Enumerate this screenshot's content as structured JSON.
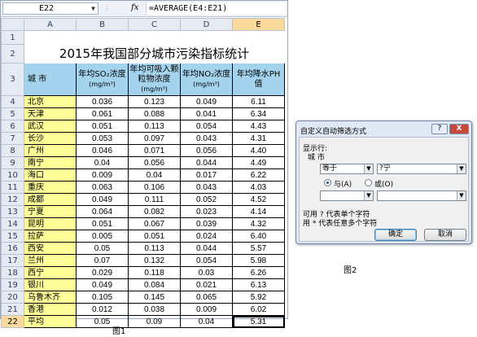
{
  "formula_bar": {
    "name_box": "E22",
    "fx_label": "fx",
    "formula": "=AVERAGE(E4:E21)"
  },
  "columns": [
    "A",
    "B",
    "C",
    "D",
    "E"
  ],
  "title": "2015年我国部分城市污染指标统计",
  "headers": {
    "city": "城    市",
    "so2": "年均SO₂浓度",
    "so2_unit": "(mg/m³)",
    "pm": "年均可吸入颗粒物浓度",
    "pm_unit": "(mg/m³)",
    "no2": "年均NO₂浓度",
    "no2_unit": "(mg/m³)",
    "ph": "年均降水PH值"
  },
  "rows": [
    {
      "r": "4",
      "city": "北京",
      "so2": "0.036",
      "pm": "0.123",
      "no2": "0.049",
      "ph": "6.11"
    },
    {
      "r": "5",
      "city": "天津",
      "so2": "0.061",
      "pm": "0.088",
      "no2": "0.041",
      "ph": "6.34"
    },
    {
      "r": "6",
      "city": "武汉",
      "so2": "0.051",
      "pm": "0.113",
      "no2": "0.054",
      "ph": "4.43"
    },
    {
      "r": "7",
      "city": "长沙",
      "so2": "0.053",
      "pm": "0.097",
      "no2": "0.043",
      "ph": "4.31"
    },
    {
      "r": "8",
      "city": "广州",
      "so2": "0.046",
      "pm": "0.071",
      "no2": "0.056",
      "ph": "4.40"
    },
    {
      "r": "9",
      "city": "南宁",
      "so2": "0.04",
      "pm": "0.056",
      "no2": "0.044",
      "ph": "4.49"
    },
    {
      "r": "10",
      "city": "海口",
      "so2": "0.009",
      "pm": "0.04",
      "no2": "0.017",
      "ph": "6.22"
    },
    {
      "r": "11",
      "city": "重庆",
      "so2": "0.063",
      "pm": "0.106",
      "no2": "0.043",
      "ph": "4.03"
    },
    {
      "r": "12",
      "city": "成都",
      "so2": "0.049",
      "pm": "0.111",
      "no2": "0.052",
      "ph": "4.52"
    },
    {
      "r": "13",
      "city": "宁夏",
      "so2": "0.064",
      "pm": "0.082",
      "no2": "0.023",
      "ph": "4.14"
    },
    {
      "r": "14",
      "city": "昆明",
      "so2": "0.051",
      "pm": "0.067",
      "no2": "0.039",
      "ph": "4.32"
    },
    {
      "r": "15",
      "city": "拉萨",
      "so2": "0.005",
      "pm": "0.051",
      "no2": "0.024",
      "ph": "6.40"
    },
    {
      "r": "16",
      "city": "西安",
      "so2": "0.05",
      "pm": "0.113",
      "no2": "0.044",
      "ph": "5.57"
    },
    {
      "r": "17",
      "city": "兰州",
      "so2": "0.07",
      "pm": "0.132",
      "no2": "0.054",
      "ph": "5.98"
    },
    {
      "r": "18",
      "city": "西宁",
      "so2": "0.029",
      "pm": "0.118",
      "no2": "0.03",
      "ph": "6.26"
    },
    {
      "r": "19",
      "city": "银川",
      "so2": "0.049",
      "pm": "0.084",
      "no2": "0.021",
      "ph": "6.13"
    },
    {
      "r": "20",
      "city": "乌鲁木齐",
      "so2": "0.105",
      "pm": "0.145",
      "no2": "0.065",
      "ph": "5.92"
    },
    {
      "r": "21",
      "city": "香港",
      "so2": "0.012",
      "pm": "0.038",
      "no2": "0.009",
      "ph": "6.02"
    },
    {
      "r": "22",
      "city": "平均",
      "so2": "0.05",
      "pm": "0.09",
      "no2": "0.04",
      "ph": "5.31"
    }
  ],
  "row_numbers_top": [
    "1",
    "2",
    "3"
  ],
  "dialog": {
    "title": "自定义自动筛选方式",
    "help": "?",
    "close": "X",
    "show_rows": "显示行:",
    "field": "城    市",
    "op1": "等于",
    "val1": "?宁",
    "and_label": "与(A)",
    "or_label": "或(O)",
    "op2": "",
    "val2": "",
    "hint1": "可用 ? 代表单个字符",
    "hint2": "用 * 代表任意多个字符",
    "ok": "确定",
    "cancel": "取消"
  },
  "captions": {
    "fig1": "图1",
    "fig2": "图2"
  }
}
